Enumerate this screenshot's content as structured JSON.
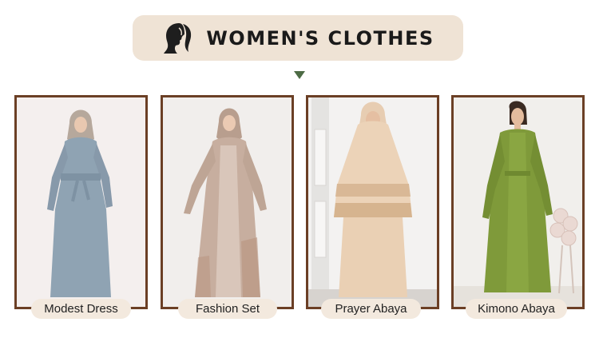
{
  "header": {
    "title": "WOMEN'S CLOTHES",
    "icon": "woman-silhouette-icon",
    "banner_color": "#efe3d5",
    "arrow_color": "#4d6b45"
  },
  "products": [
    {
      "label": "Modest Dress",
      "garment_color": "#8fa3b3"
    },
    {
      "label": "Fashion Set",
      "garment_color": "#d2bfb0"
    },
    {
      "label": "Prayer Abaya",
      "garment_color": "#ecd3b8"
    },
    {
      "label": "Kimono Abaya",
      "garment_color": "#7f9a3a"
    }
  ],
  "colors": {
    "card_border": "#6b3f25",
    "pill_background": "#f3e9de"
  }
}
